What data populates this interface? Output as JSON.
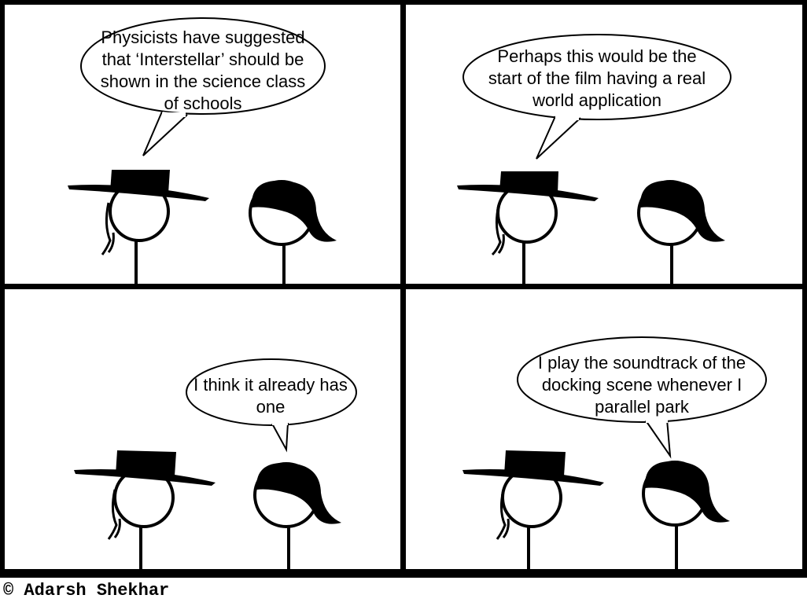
{
  "panels": [
    {
      "speaker": "man-with-hat",
      "text": "Physicists have suggested that ‘Interstellar’ should be shown in the science class of schools"
    },
    {
      "speaker": "man-with-hat",
      "text": "Perhaps this would be the start of the film having a real world application"
    },
    {
      "speaker": "woman",
      "text": "I think it already has one"
    },
    {
      "speaker": "woman",
      "text": "I play the soundtrack of the docking scene whenever I parallel park"
    }
  ],
  "credit": "© Adarsh Shekhar"
}
